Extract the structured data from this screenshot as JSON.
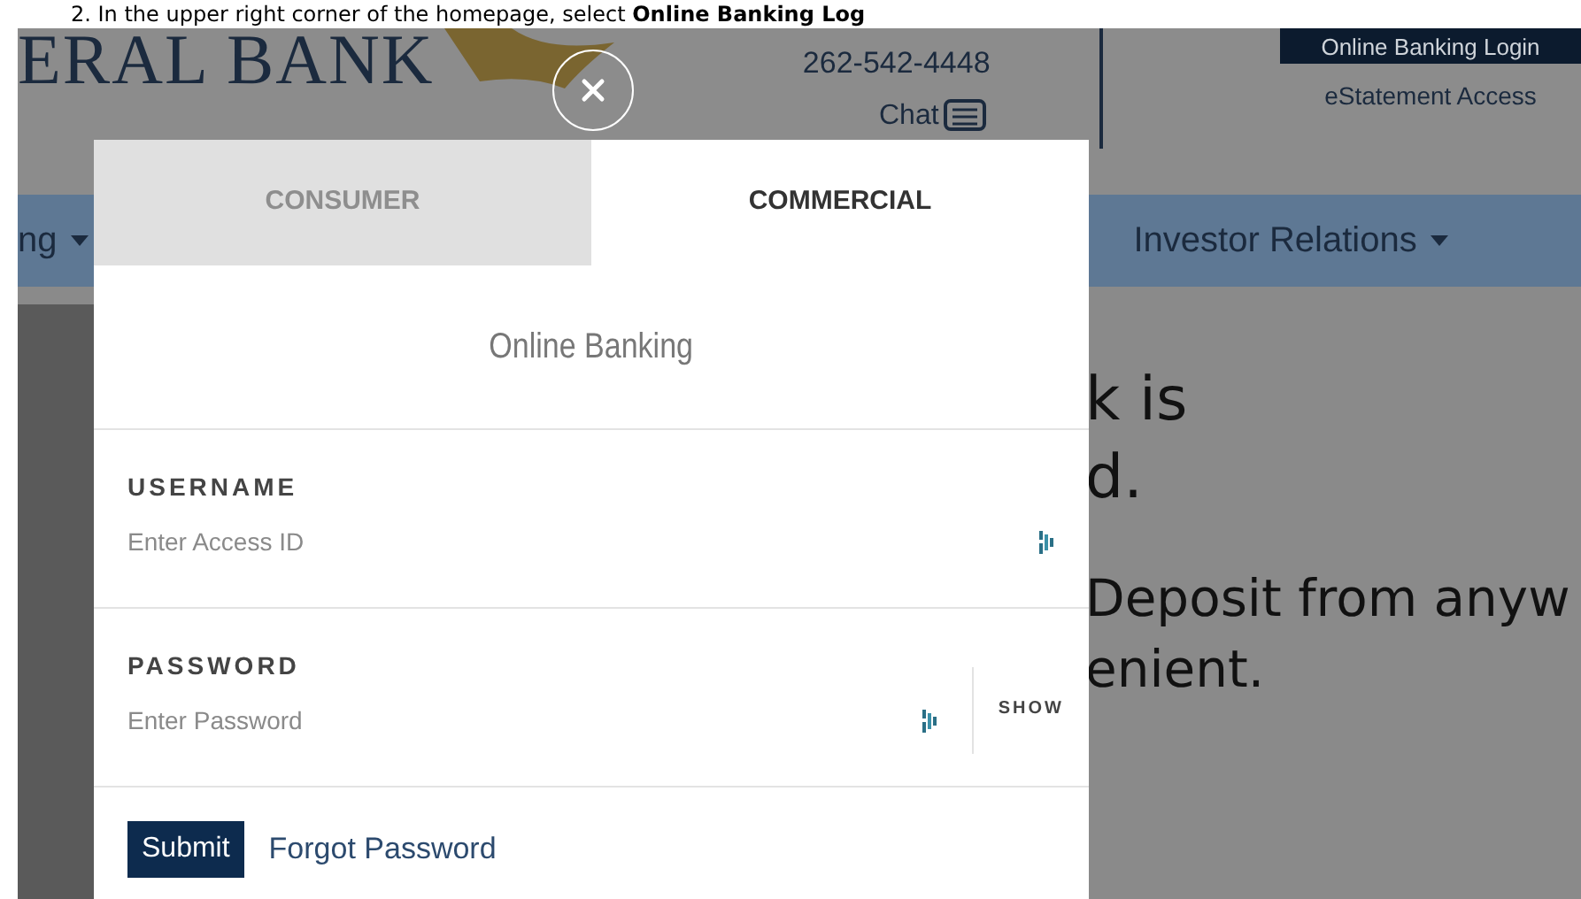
{
  "instruction": "2. In the upper right corner of the homepage, select **Online Banking Log**",
  "site": {
    "logo_text": "ERAL BANK",
    "phone": "262-542-4448",
    "chat": "Chat",
    "login_button": "Online Banking Login",
    "estatement_link": "eStatement Access",
    "nav": [
      {
        "label": "ng"
      },
      {
        "label": "Investor Relations"
      }
    ],
    "hero_lines": [
      "k is",
      "d.",
      "Deposit from anyw",
      "enient."
    ]
  },
  "modal": {
    "tabs": [
      {
        "label": "CONSUMER",
        "selected": false
      },
      {
        "label": "COMMERCIAL",
        "selected": true
      }
    ],
    "title": "Online Banking",
    "fields": [
      {
        "label": "USERNAME",
        "placeholder": "Enter Access ID"
      },
      {
        "label": "PASSWORD",
        "placeholder": "Enter Password",
        "toggle": "SHOW"
      }
    ],
    "submit": "Submit",
    "forgot": "Forgot Password"
  }
}
